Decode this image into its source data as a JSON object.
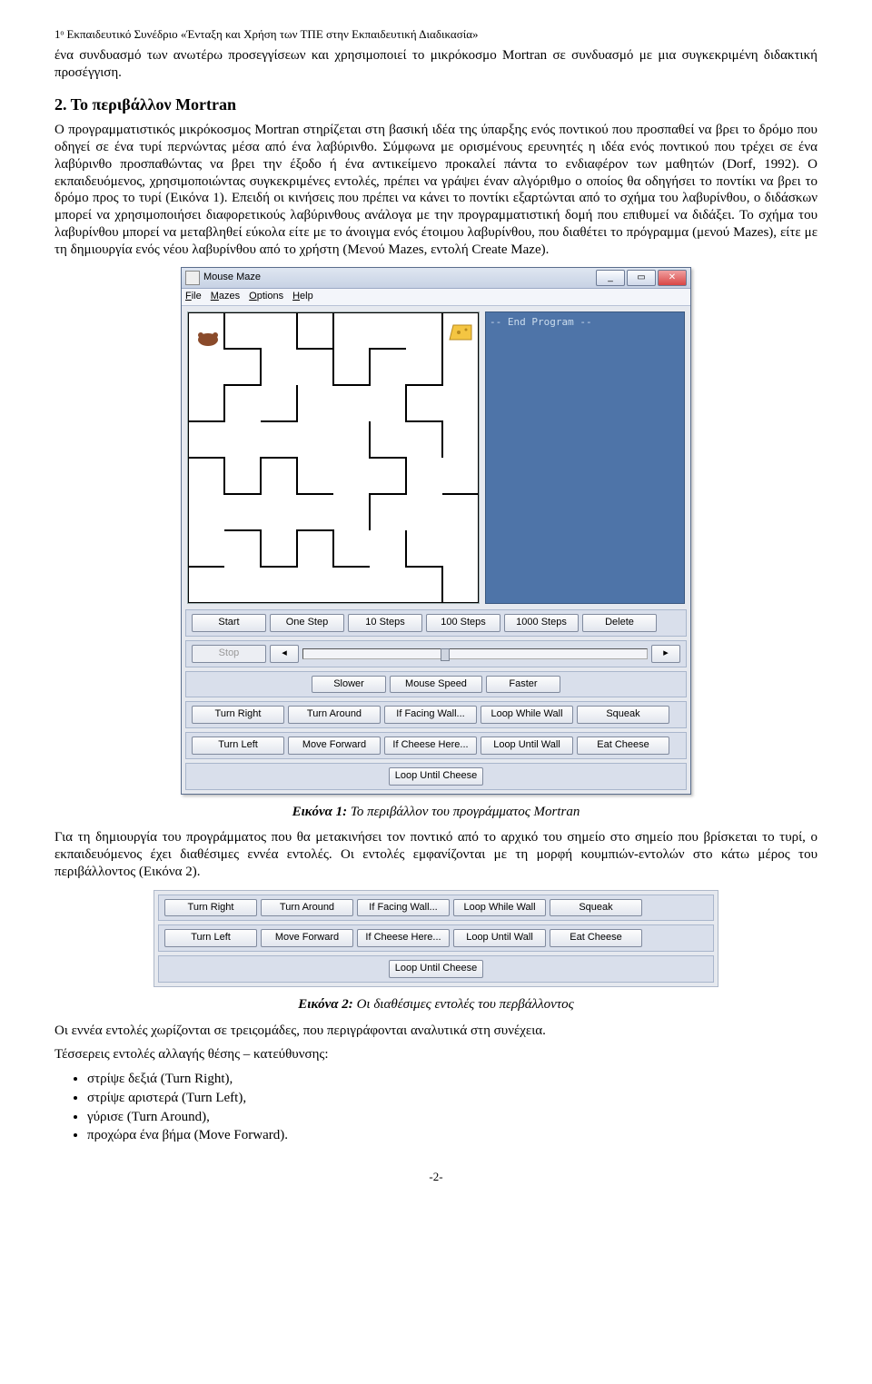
{
  "header": "1ᵒ Εκπαιδευτικό Συνέδριο «Ένταξη και Χρήση των ΤΠΕ στην Εκπαιδευτική Διαδικασία»",
  "intro_para": "ένα συνδυασμό των ανωτέρω προσεγγίσεων και χρησιμοποιεί το μικρόκοσμο Mortran σε συνδυασμό με μια συγκεκριμένη διδακτική προσέγγιση.",
  "section_title": "2. Το περιβάλλον Mortran",
  "section_para": "Ο προγραμματιστικός μικρόκοσμος Mortran στηρίζεται στη βασική ιδέα της ύπαρξης ενός ποντικού που προσπαθεί να βρει το δρόμο που οδηγεί σε ένα τυρί περνώντας μέσα από ένα λαβύρινθο. Σύμφωνα με ορισμένους ερευνητές η ιδέα ενός ποντικού που τρέχει σε ένα λαβύρινθο προσπαθώντας να βρει την έξοδο ή ένα αντικείμενο προκαλεί πάντα το ενδιαφέρον των μαθητών (Dorf, 1992). Ο εκπαιδευόμενος, χρησιμοποιώντας συγκεκριμένες εντολές, πρέπει να γράψει έναν αλγόριθμο ο οποίος θα οδηγήσει το ποντίκι να βρει το δρόμο προς το τυρί (Εικόνα 1). Επειδή οι κινήσεις που πρέπει να κάνει το ποντίκι εξαρτώνται από το σχήμα του λαβυρίνθου, ο διδάσκων μπορεί να χρησιμοποιήσει διαφορετικούς λαβύρινθους ανάλογα με την προγραμματιστική δομή που επιθυμεί να διδάξει. Το σχήμα του λαβυρίνθου μπορεί να μεταβληθεί εύκολα είτε με το άνοιγμα ενός έτοιμου λαβυρίνθου, που διαθέτει το πρόγραμμα (μενού Mazes), είτε με τη δημιουργία ενός νέου λαβυρίνθου από το χρήστη (Μενού Mazes, εντολή Create Maze).",
  "app": {
    "title": "Mouse Maze",
    "menu": [
      "File",
      "Mazes",
      "Options",
      "Help"
    ],
    "side_text": "-- End Program --",
    "row1": [
      "Start",
      "One Step",
      "10 Steps",
      "100 Steps",
      "1000 Steps",
      "Delete"
    ],
    "stop": "Stop",
    "slower": "Slower",
    "speed": "Mouse Speed",
    "faster": "Faster",
    "row3": [
      "Turn Right",
      "Turn Around",
      "If Facing Wall...",
      "Loop While Wall",
      "Squeak"
    ],
    "row4": [
      "Turn Left",
      "Move Forward",
      "If Cheese Here...",
      "Loop Until Wall",
      "Eat Cheese"
    ],
    "row5": "Loop Until Cheese"
  },
  "caption1_label": "Εικόνα 1:",
  "caption1_text": "Το περιβάλλον του προγράμματος Mortran",
  "para_after_fig1": "Για τη δημιουργία του προγράμματος που θα μετακινήσει τον ποντικό από το αρχικό του σημείο στο σημείο που βρίσκεται το τυρί, ο εκπαιδευόμενος έχει διαθέσιμες εννέα εντολές. Οι εντολές εμφανίζονται με τη μορφή κουμπιών-εντολών στο κάτω μέρος του περιβάλλοντος (Εικόνα 2).",
  "caption2_label": "Εικόνα 2:",
  "caption2_text": "Οι διαθέσιμες εντολές του περβάλλοντος",
  "para_after_fig2": "Οι εννέα εντολές χωρίζονται σε τρειςομάδες, που περιγράφονται αναλυτικά στη συνέχεια.",
  "list_intro": "Τέσσερεις εντολές αλλαγής θέσης – κατεύθυνσης:",
  "bullets": [
    "στρίψε δεξιά (Turn Right),",
    "στρίψε αριστερά (Turn Left),",
    "γύρισε (Turn Around),",
    "προχώρα ένα βήμα (Move Forward)."
  ],
  "pagenum": "-2-"
}
